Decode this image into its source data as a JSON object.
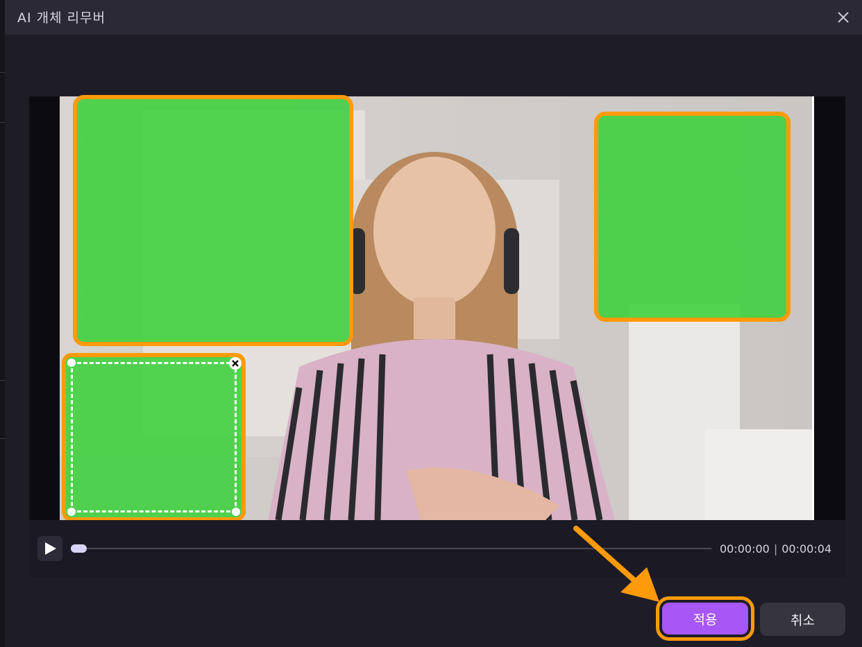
{
  "window": {
    "title": "AI 개체 리무버"
  },
  "colors": {
    "mask": "#3cd03c",
    "highlight": "#ff9a0a",
    "primary_button": "#a657f5",
    "secondary_button": "#35343f"
  },
  "player": {
    "current_time": "00:00:00",
    "separator": "|",
    "total_time": "00:00:04",
    "progress": 0
  },
  "regions": [
    {
      "name": "mask-region-top-left",
      "selected": false
    },
    {
      "name": "mask-region-top-right",
      "selected": false
    },
    {
      "name": "mask-region-bottom-left",
      "selected": true
    }
  ],
  "icons": {
    "close": "close-icon",
    "play": "play-icon",
    "delete_region": "delete-region-icon",
    "annotation_arrow": "arrow-icon"
  },
  "footer": {
    "apply_label": "적용",
    "cancel_label": "취소"
  }
}
